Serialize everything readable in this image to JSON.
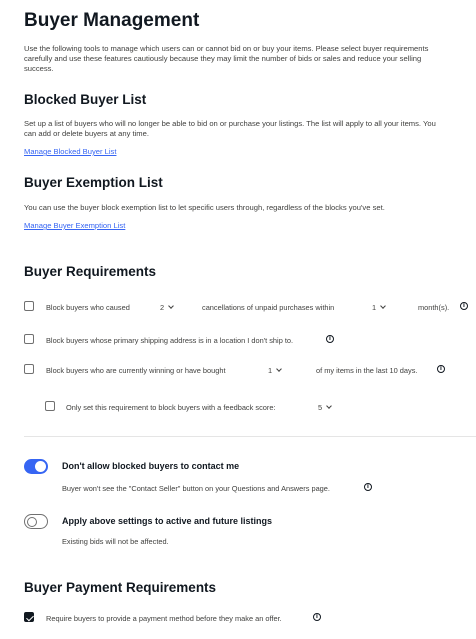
{
  "page_title": "Buyer Management",
  "intro": "Use the following tools to manage which users can or cannot bid on or buy your items. Please select buyer requirements carefully and use these features cautiously because they may limit the number of bids or sales and reduce your selling success.",
  "blocked": {
    "title": "Blocked Buyer List",
    "desc": "Set up a list of buyers who will no longer be able to bid on or purchase your listings. The list will apply to all your items. You can add or delete buyers at any time.",
    "link": "Manage Blocked Buyer List"
  },
  "exemption": {
    "title": "Buyer Exemption List",
    "desc": "You can use the buyer block exemption list to let specific users through, regardless of the blocks you've set.",
    "link": "Manage Buyer Exemption List"
  },
  "requirements": {
    "title": "Buyer Requirements",
    "row1": {
      "text_a": "Block buyers who caused",
      "select1": "2",
      "text_b": "cancellations of unpaid purchases within",
      "select2": "1",
      "text_c": "month(s).",
      "checked": false
    },
    "row2": {
      "text": "Block buyers whose primary shipping address is in a location I don't ship to.",
      "checked": false
    },
    "row3": {
      "text_a": "Block buyers who are currently winning or have bought",
      "select": "1",
      "text_b": "of my items in the last 10 days.",
      "checked": false
    },
    "row4": {
      "text": "Only set this requirement to block buyers with a feedback score:",
      "select": "5",
      "checked": false
    }
  },
  "contact": {
    "label": "Don't allow blocked buyers to contact me",
    "desc": "Buyer won't see the \"Contact Seller\" button on your Questions and Answers page.",
    "on": true
  },
  "apply": {
    "label": "Apply above settings to active and future listings",
    "desc": "Existing bids will not be affected.",
    "on": false
  },
  "payment": {
    "title": "Buyer Payment Requirements",
    "row": {
      "text": "Require buyers to provide a payment method before they make an offer.",
      "checked": true
    }
  },
  "icons": {
    "info": "i"
  },
  "colors": {
    "accent": "#3665f3",
    "text": "#111820",
    "muted": "#41413f"
  }
}
